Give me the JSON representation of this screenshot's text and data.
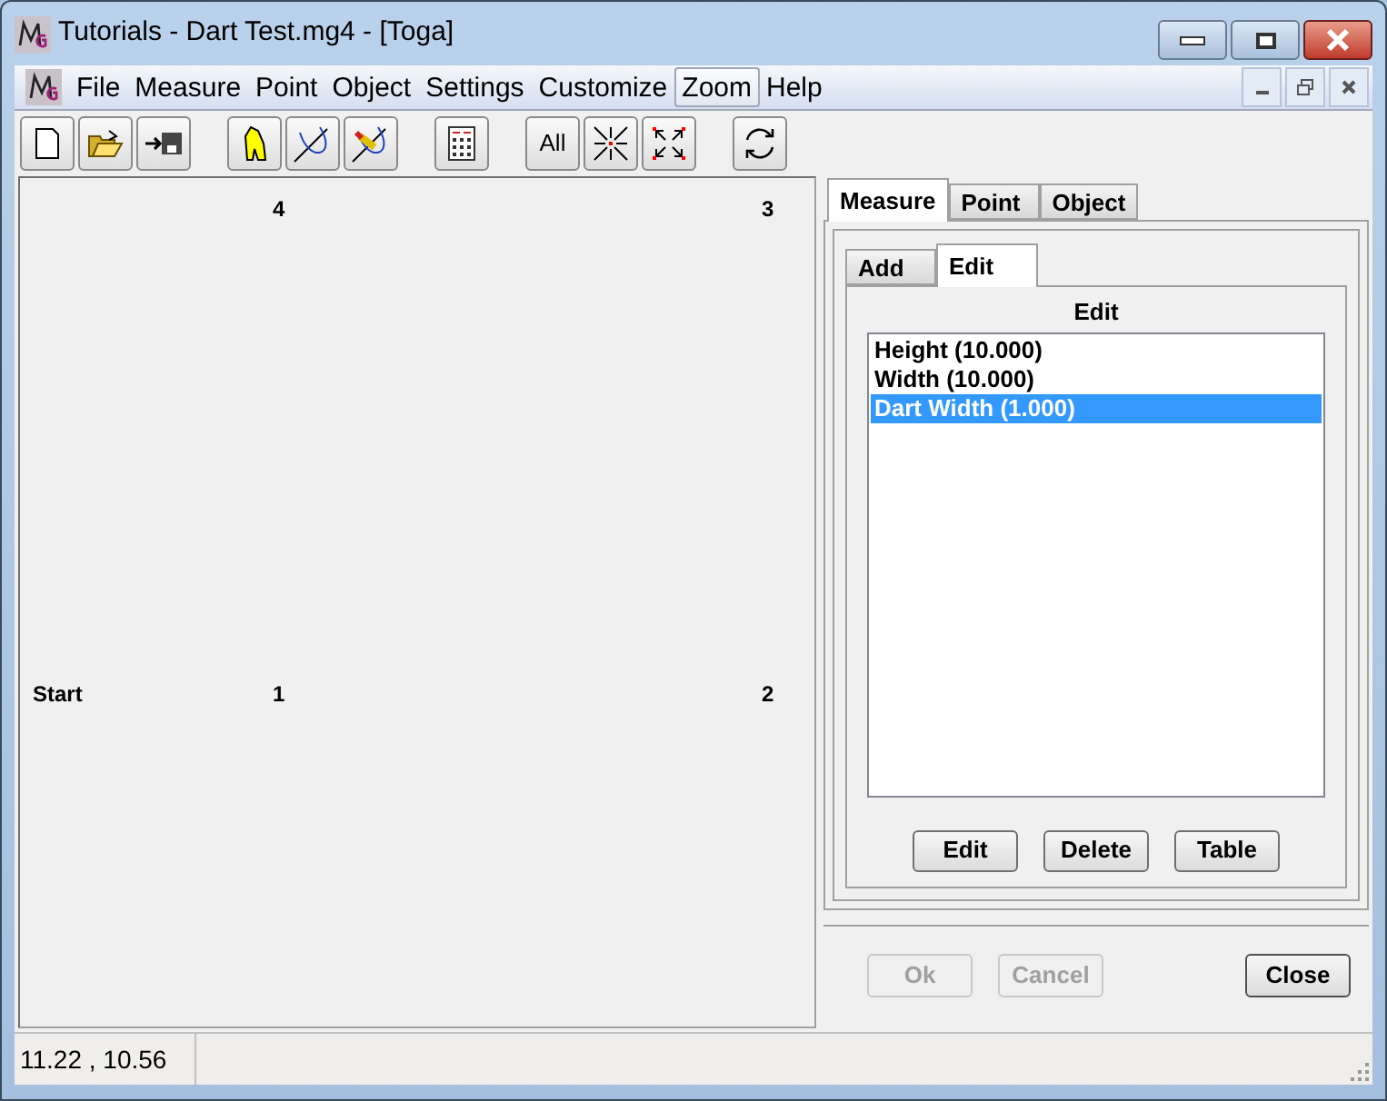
{
  "window": {
    "title": "Tutorials - Dart Test.mg4 - [Toga]"
  },
  "menu": [
    {
      "label": "File",
      "selected": false
    },
    {
      "label": "Measure",
      "selected": false
    },
    {
      "label": "Point",
      "selected": false
    },
    {
      "label": "Object",
      "selected": false
    },
    {
      "label": "Settings",
      "selected": false
    },
    {
      "label": "Customize",
      "selected": false
    },
    {
      "label": "Zoom",
      "selected": true
    },
    {
      "label": "Help",
      "selected": false
    }
  ],
  "toolbar": {
    "all_label": "All"
  },
  "canvas": {
    "points": [
      {
        "label": "4"
      },
      {
        "label": "3"
      },
      {
        "label": "Start"
      },
      {
        "label": "1"
      },
      {
        "label": "2"
      }
    ]
  },
  "tabs": [
    {
      "label": "Measure",
      "selected": true
    },
    {
      "label": "Point",
      "selected": false
    },
    {
      "label": "Object",
      "selected": false
    }
  ],
  "subtabs": [
    {
      "label": "Add",
      "selected": false
    },
    {
      "label": "Edit",
      "selected": true
    }
  ],
  "edit_panel": {
    "heading": "Edit",
    "items": [
      {
        "label": "Height (10.000)",
        "selected": false
      },
      {
        "label": "Width (10.000)",
        "selected": false
      },
      {
        "label": "Dart Width (1.000)",
        "selected": true
      }
    ],
    "buttons": [
      "Edit",
      "Delete",
      "Table"
    ]
  },
  "dialog_buttons": [
    {
      "label": "Ok",
      "disabled": true
    },
    {
      "label": "Cancel",
      "disabled": true
    },
    {
      "label": "Close",
      "disabled": false
    }
  ],
  "status_bar": {
    "coordinates": "11.22 , 10.56"
  }
}
